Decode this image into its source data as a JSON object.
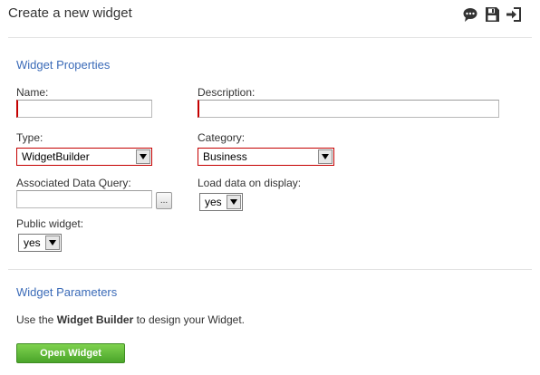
{
  "header": {
    "title": "Create a new widget",
    "icons": [
      "comment-icon",
      "save-icon",
      "exit-icon"
    ]
  },
  "properties": {
    "section_title": "Widget Properties",
    "name_label": "Name:",
    "name_value": "",
    "description_label": "Description:",
    "description_value": "",
    "type_label": "Type:",
    "type_value": "WidgetBuilder",
    "category_label": "Category:",
    "category_value": "Business",
    "query_label": "Associated Data Query:",
    "query_value": "",
    "browse_label": "...",
    "load_label": "Load data on display:",
    "load_value": "yes",
    "public_label": "Public widget:",
    "public_value": "yes"
  },
  "parameters": {
    "section_title": "Widget Parameters",
    "text_prefix": "Use the ",
    "text_bold": "Widget Builder",
    "text_suffix": " to design your Widget.",
    "open_button": "Open Widget"
  },
  "colors": {
    "accent": "#3b6bb8",
    "required": "#c40000",
    "button_green": "#5cb836"
  }
}
